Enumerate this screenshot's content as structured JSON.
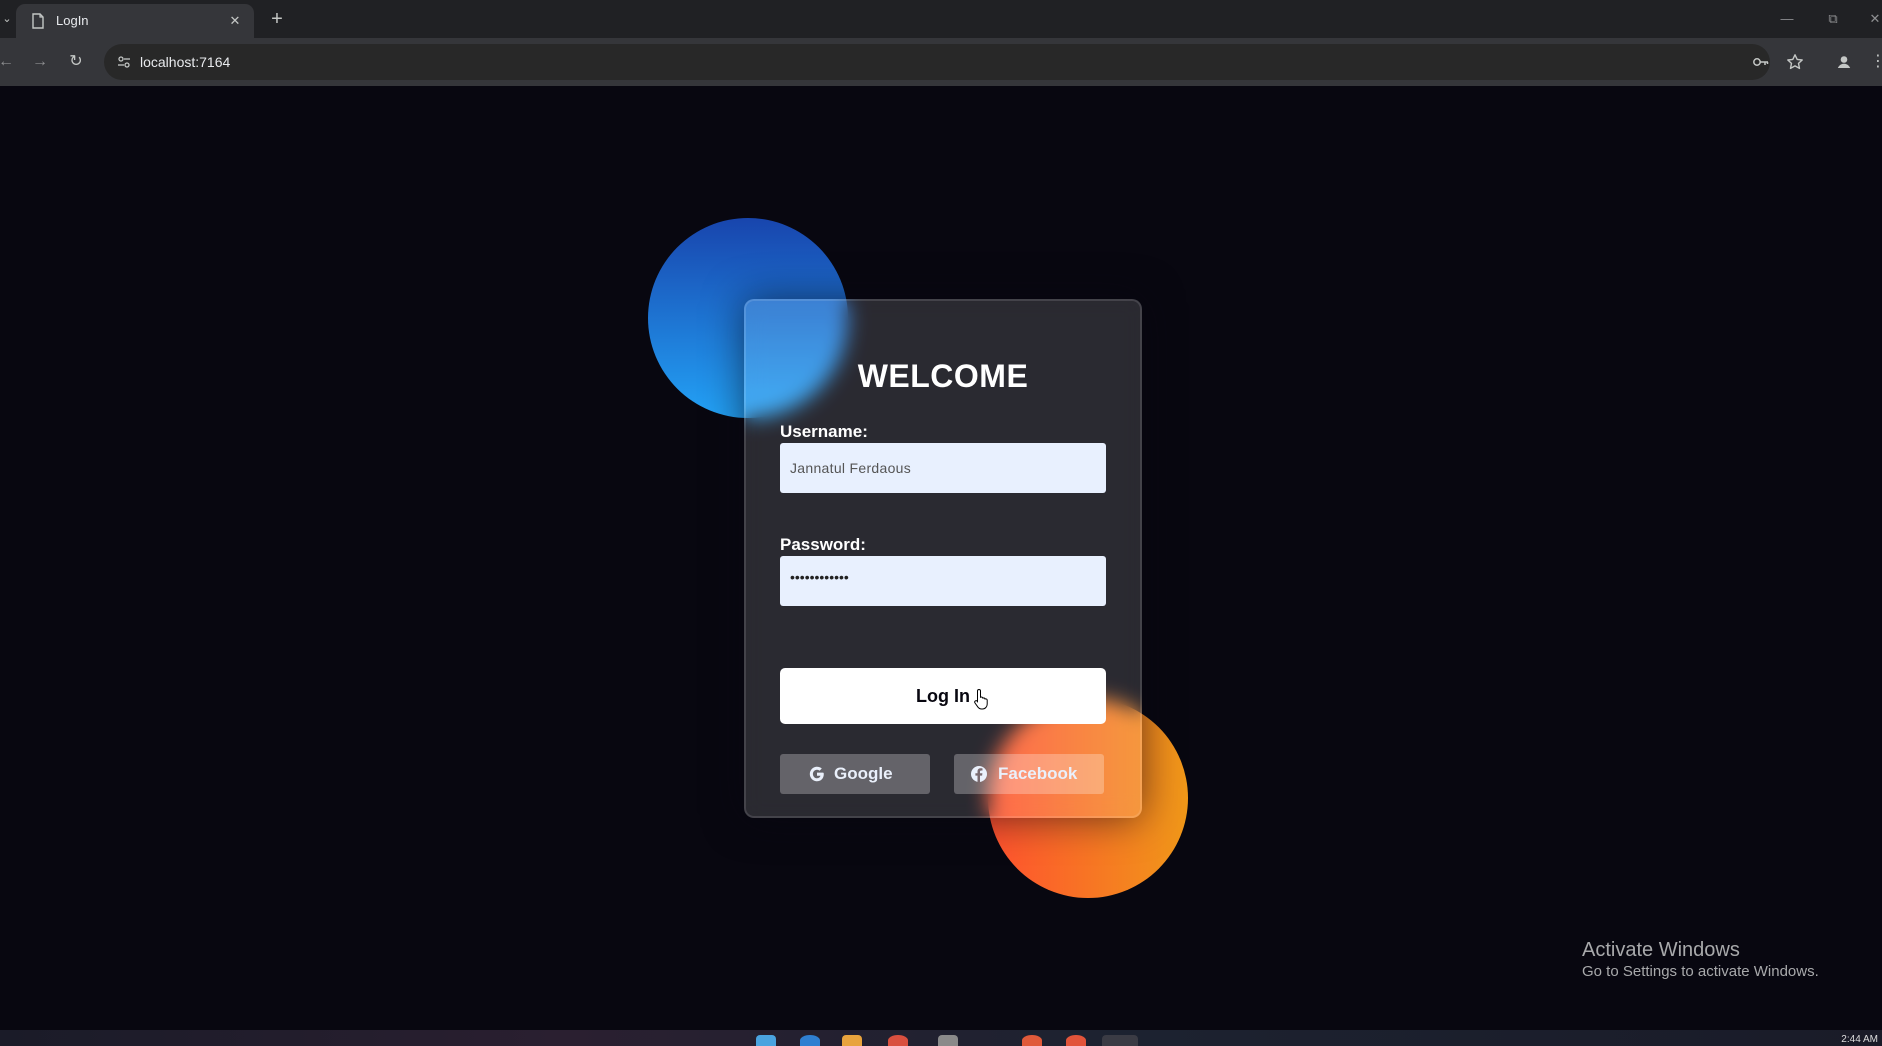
{
  "browser": {
    "tab_title": "LogIn",
    "url": "localhost:7164"
  },
  "page": {
    "title": "WELCOME",
    "username_label": "Username:",
    "username_value": "Jannatul Ferdaous",
    "password_label": "Password:",
    "password_masked": "••••••••••••",
    "login_label": "Log In",
    "google_label": "Google",
    "facebook_label": "Facebook"
  },
  "watermark": {
    "title": "Activate Windows",
    "subtitle": "Go to Settings to activate Windows."
  },
  "taskbar": {
    "clock": "2:44 AM"
  },
  "colors": {
    "background": "#080710",
    "blue_shape": "#1845ad",
    "orange_shape": "#ff512f",
    "input_bg": "#e8f0fe"
  }
}
